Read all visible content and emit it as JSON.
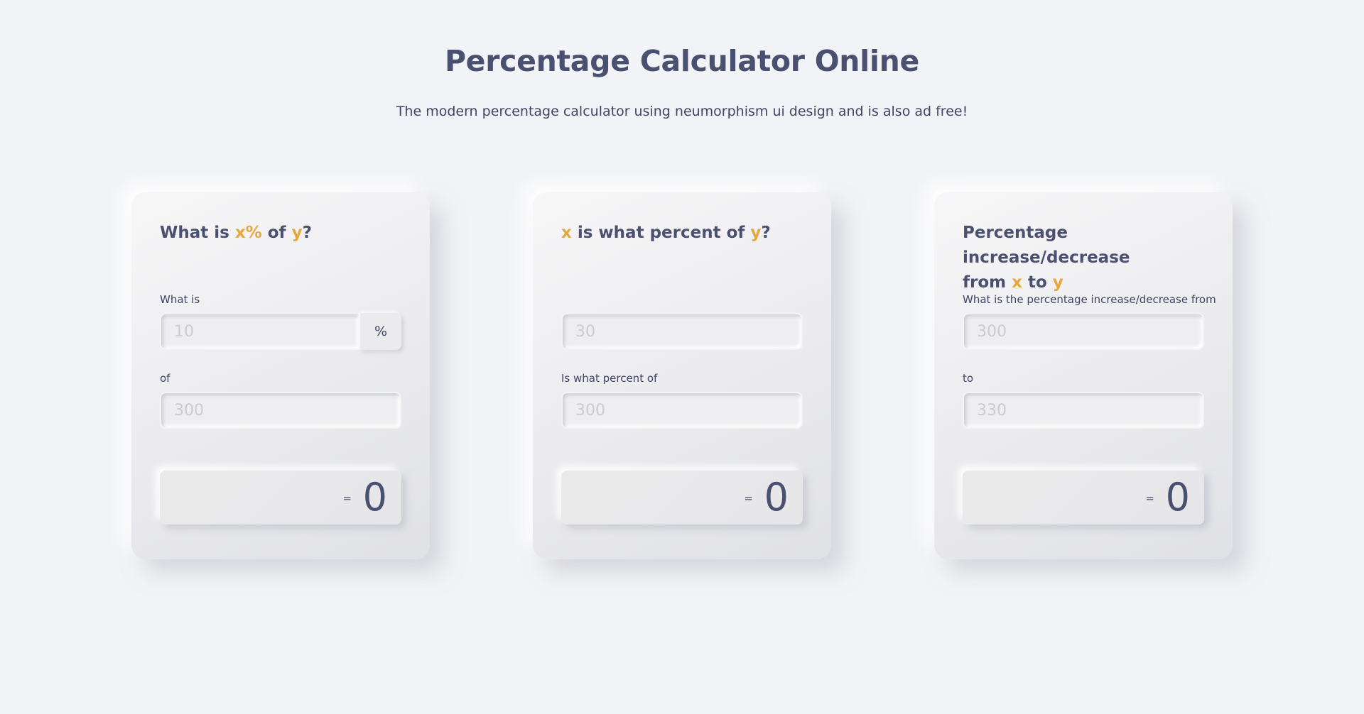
{
  "header": {
    "title": "Percentage Calculator Online",
    "subtitle": "The modern percentage calculator using neumorphism ui design and is also ad free!"
  },
  "colors": {
    "background": "#f2f3f6",
    "text": "#444b6a",
    "highlight": "#e6a73d"
  },
  "cards": [
    {
      "title_parts": [
        "What is ",
        "x%",
        " of ",
        "y",
        "?"
      ],
      "label1": "What is",
      "input1_placeholder": "10",
      "addon": "%",
      "label2": "of",
      "input2_placeholder": "300",
      "equals": "=",
      "result": "0"
    },
    {
      "title_parts": [
        "x",
        " is what percent of ",
        "y",
        "?"
      ],
      "label1": "",
      "input1_placeholder": "30",
      "label2": "Is what percent of",
      "input2_placeholder": "300",
      "equals": "=",
      "result": "0"
    },
    {
      "title_line1": "Percentage increase/decrease",
      "title_parts": [
        "from ",
        "x",
        " to ",
        "y"
      ],
      "label1": "What is the percentage increase/decrease from",
      "input1_placeholder": "300",
      "label2": "to",
      "input2_placeholder": "330",
      "equals": "=",
      "result": "0"
    }
  ]
}
